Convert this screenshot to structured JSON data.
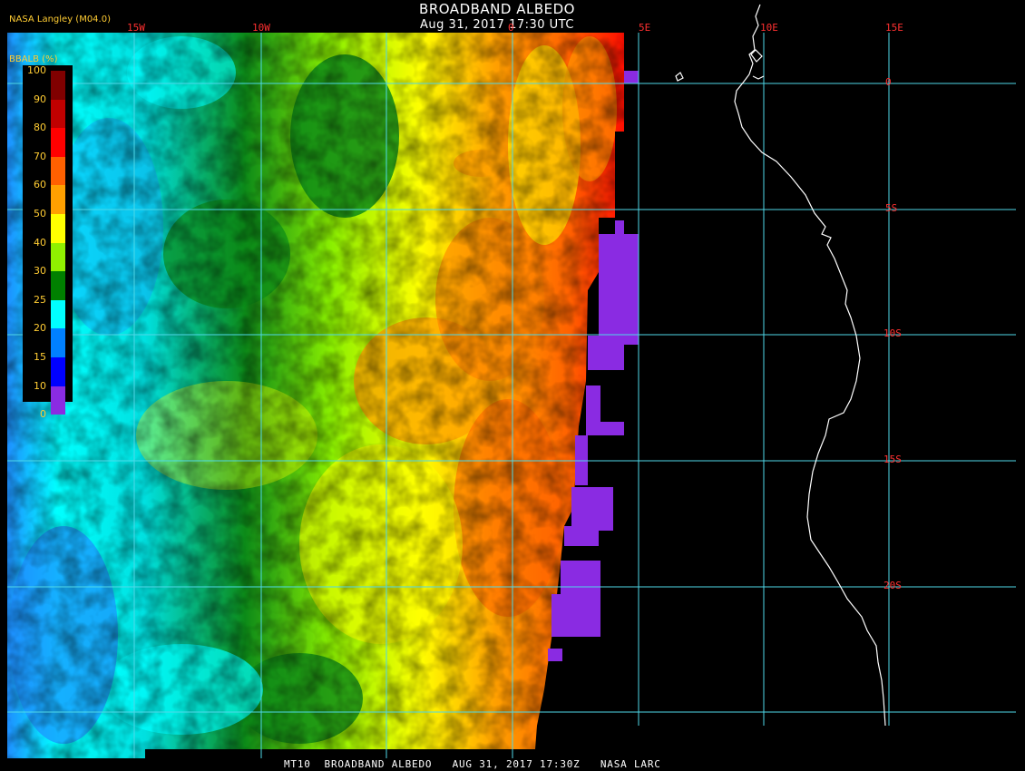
{
  "header": {
    "title": "BROADBAND ALBEDO",
    "timestamp": "Aug 31, 2017 17:30 UTC",
    "credit": "NASA Langley (M04.0)"
  },
  "map": {
    "lon_labels": [
      "15W",
      "10W",
      "0",
      "5E",
      "10E",
      "15E"
    ],
    "lat_labels": [
      "0",
      "5S",
      "10S",
      "15S",
      "20S"
    ],
    "grid_color": "#4fd8e8",
    "label_color": "#ff3030",
    "coastline_color": "#ffffff"
  },
  "legend": {
    "title": "BBALB (%)",
    "ticks": [
      "100",
      "90",
      "80",
      "70",
      "60",
      "50",
      "40",
      "30",
      "25",
      "20",
      "15",
      "10",
      "0"
    ],
    "colors": [
      "#800000",
      "#c00000",
      "#ff0000",
      "#ff6000",
      "#ffa000",
      "#ffff00",
      "#90f000",
      "#008000",
      "#00ffff",
      "#0080ff",
      "#0000ff",
      "#8a2be2"
    ]
  },
  "footer": {
    "text": "MT10  BROADBAND ALBEDO   AUG 31, 2017 17:30Z   NASA LARC"
  }
}
